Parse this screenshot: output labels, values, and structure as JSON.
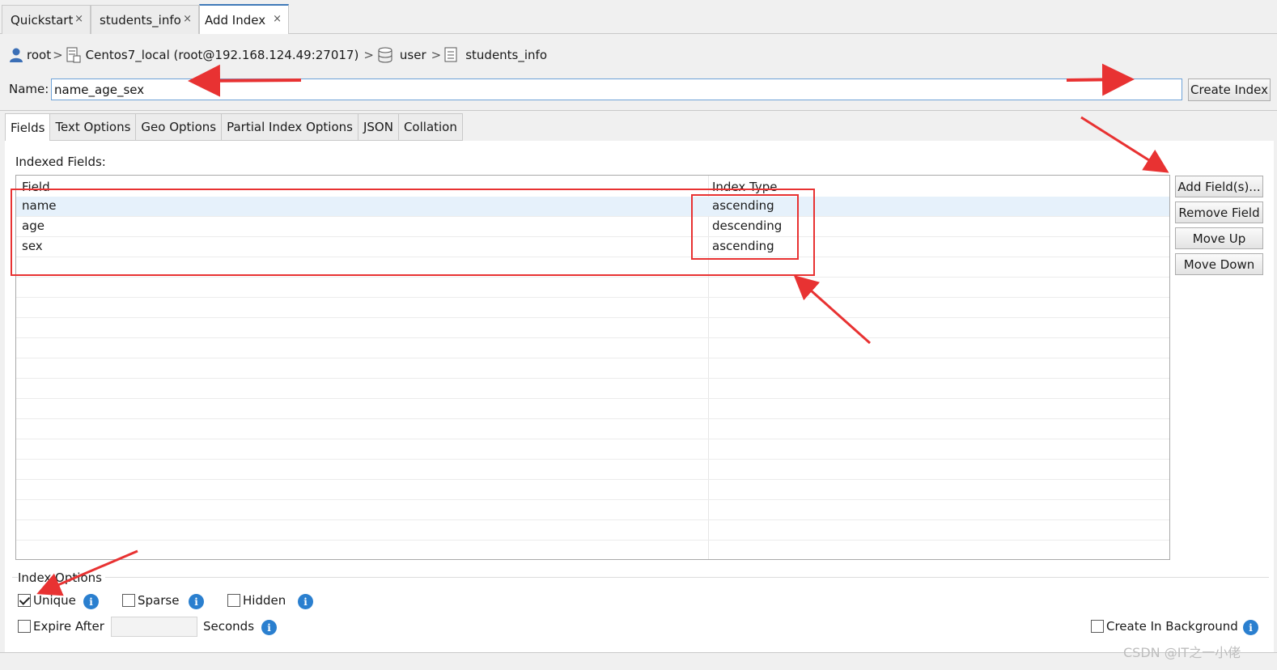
{
  "top_tabs": [
    {
      "label": "Quickstart",
      "close": "×"
    },
    {
      "label": "students_info",
      "close": "×"
    },
    {
      "label": "Add Index",
      "close": "×"
    }
  ],
  "breadcrumb": {
    "user": "root",
    "connection": "Centos7_local (root@192.168.124.49:27017)",
    "database": "user",
    "collection": "students_info",
    "separator": ">"
  },
  "name_row": {
    "label": "Name:",
    "value": "name_age_sex",
    "create_button": "Create Index"
  },
  "sub_tabs": [
    "Fields",
    "Text Options",
    "Geo Options",
    "Partial Index Options",
    "JSON",
    "Collation"
  ],
  "fields_panel": {
    "title": "Indexed Fields:",
    "columns": [
      "Field",
      "Index Type"
    ],
    "rows": [
      {
        "field": "name",
        "type": "ascending"
      },
      {
        "field": "age",
        "type": "descending"
      },
      {
        "field": "sex",
        "type": "ascending"
      }
    ],
    "buttons": [
      "Add Field(s)...",
      "Remove Field",
      "Move Up",
      "Move Down"
    ]
  },
  "index_options": {
    "title": "Index Options",
    "unique": {
      "label": "Unique",
      "checked": true
    },
    "sparse": {
      "label": "Sparse",
      "checked": false
    },
    "hidden": {
      "label": "Hidden",
      "checked": false
    },
    "expire_after": {
      "label": "Expire After",
      "checked": false,
      "value": "",
      "unit": "Seconds"
    },
    "background": {
      "label": "Create In Background",
      "checked": false
    },
    "info_symbol": "i"
  },
  "watermark": "CSDN @IT之一小佬",
  "colors": {
    "annotation": "#e83232",
    "accent": "#3f79b8",
    "info": "#2a7fcf",
    "selected_row": "#e6f1fb"
  },
  "icons": [
    "user-icon",
    "connection-icon",
    "database-icon",
    "collection-icon",
    "close-icon",
    "info-icon",
    "checkbox-icon"
  ]
}
